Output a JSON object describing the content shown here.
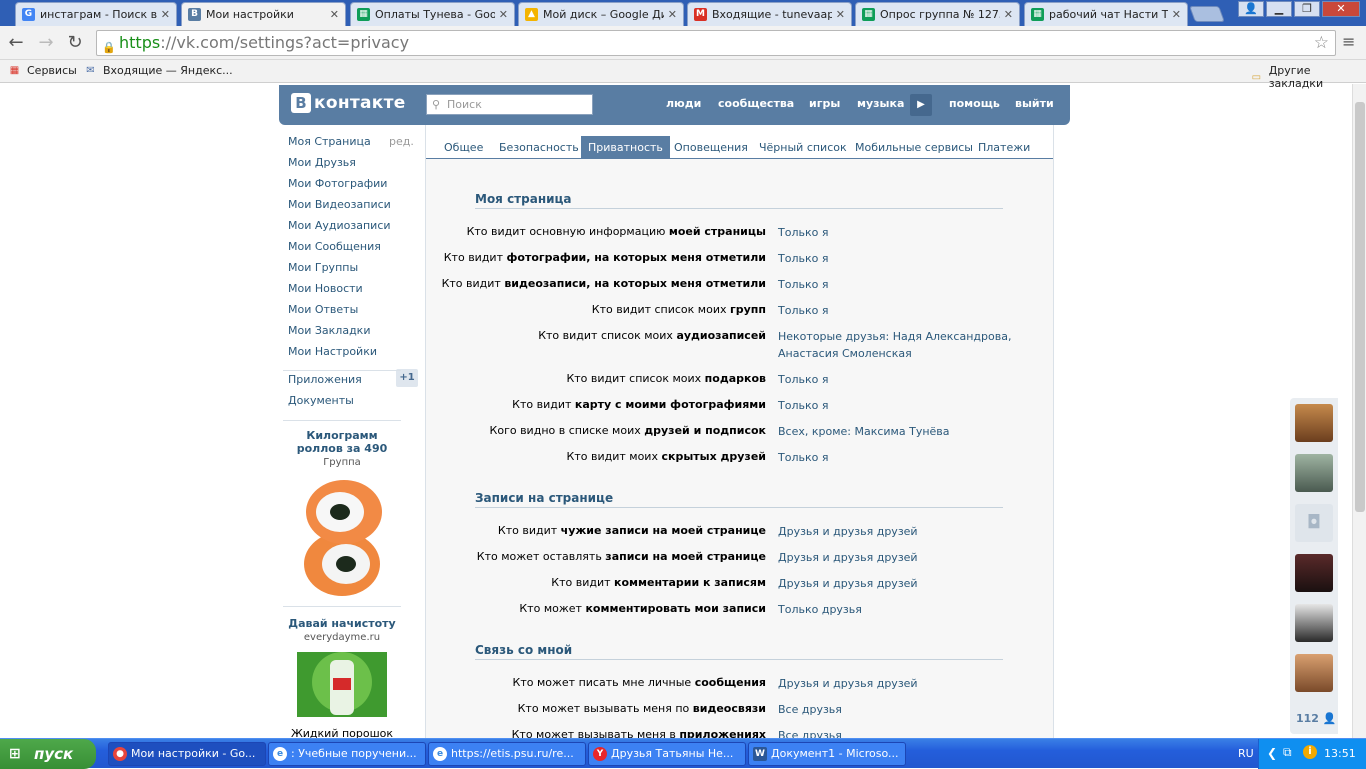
{
  "browser": {
    "tabs": [
      {
        "title": "инстаграм - Поиск в Go",
        "icon": "G",
        "color": "#4285f4"
      },
      {
        "title": "Мои настройки",
        "icon": "В",
        "color": "#597da3"
      },
      {
        "title": "Оплаты Тунева - Goog",
        "icon": "▦",
        "color": "#0f9d58"
      },
      {
        "title": "Мой диск – Google Дис",
        "icon": "▲",
        "color": "#f4b400"
      },
      {
        "title": "Входящие - tunevaap@",
        "icon": "M",
        "color": "#d93025"
      },
      {
        "title": "Опрос группа № 1275",
        "icon": "▦",
        "color": "#0f9d58"
      },
      {
        "title": "рабочий чат Насти Тун",
        "icon": "▦",
        "color": "#0f9d58"
      }
    ],
    "url_https": "https",
    "url_rest": "://vk.com/settings?act=privacy",
    "bookmarks": [
      {
        "label": "Сервисы"
      },
      {
        "label": "Входящие — Яндекс..."
      },
      {
        "label": "Другие закладки"
      }
    ]
  },
  "vk": {
    "logo_text": "контакте",
    "logo_letter": "В",
    "search_placeholder": "Поиск",
    "nav": [
      "люди",
      "сообщества",
      "игры",
      "музыка",
      "помощь",
      "выйти"
    ],
    "left_menu": [
      "Моя Страница",
      "Мои Друзья",
      "Мои Фотографии",
      "Мои Видеозаписи",
      "Мои Аудиозаписи",
      "Мои Сообщения",
      "Мои Группы",
      "Мои Новости",
      "Мои Ответы",
      "Мои Закладки",
      "Мои Настройки"
    ],
    "edit_label": "ред.",
    "apps_label": "Приложения",
    "apps_badge": "+1",
    "docs_label": "Документы",
    "ad1": {
      "title": "Килограмм роллов за 490",
      "sub": "Группа"
    },
    "ad2": {
      "title": "Давай начистоту",
      "sub": "everydayme.ru",
      "caption": "Жидкий порошок"
    },
    "settings_tabs": [
      "Общее",
      "Безопасность",
      "Приватность",
      "Оповещения",
      "Чёрный список",
      "Мобильные сервисы",
      "Платежи"
    ],
    "sections": [
      {
        "title": "Моя страница",
        "rows": [
          {
            "pre": "Кто видит основную информацию ",
            "bold": "моей страницы",
            "value": "Только я"
          },
          {
            "pre": "Кто видит ",
            "bold": "фотографии, на которых меня отметили",
            "value": "Только я"
          },
          {
            "pre": "Кто видит ",
            "bold": "видеозаписи, на которых меня отметили",
            "value": "Только я"
          },
          {
            "pre": "Кто видит список моих ",
            "bold": "групп",
            "value": "Только я"
          },
          {
            "pre": "Кто видит список моих ",
            "bold": "аудиозаписей",
            "value": "Некоторые друзья: Надя Александрова,",
            "value2": "Анастасия Смоленская"
          },
          {
            "pre": "Кто видит список моих ",
            "bold": "подарков",
            "value": "Только я"
          },
          {
            "pre": "Кто видит ",
            "bold": "карту с моими фотографиями",
            "value": "Только я"
          },
          {
            "pre": "Кого видно в списке моих ",
            "bold": "друзей и подписок",
            "value": "Всех, кроме: Максима Тунёва"
          },
          {
            "pre": "Кто видит моих ",
            "bold": "скрытых друзей",
            "value": "Только я"
          }
        ]
      },
      {
        "title": "Записи на странице",
        "rows": [
          {
            "pre": "Кто видит ",
            "bold": "чужие записи на моей странице",
            "value": "Друзья и друзья друзей"
          },
          {
            "pre": "Кто может оставлять ",
            "bold": "записи на моей странице",
            "value": "Друзья и друзья друзей"
          },
          {
            "pre": "Кто видит ",
            "bold": "комментарии к записям",
            "value": "Друзья и друзья друзей"
          },
          {
            "pre": "Кто может ",
            "bold": "комментировать мои записи",
            "value": "Только друзья"
          }
        ]
      },
      {
        "title": "Связь со мной",
        "rows": [
          {
            "pre": "Кто может писать мне личные ",
            "bold": "сообщения",
            "value": "Друзья и друзья друзей"
          },
          {
            "pre": "Кто может вызывать меня по ",
            "bold": "видеосвязи",
            "value": "Все друзья"
          },
          {
            "pre": "Кто может вызывать меня в ",
            "bold": "приложениях",
            "value": "Все друзья"
          }
        ]
      }
    ],
    "friends_count": "112"
  },
  "taskbar": {
    "start_label": "пуск",
    "buttons": [
      {
        "label": "Мои настройки - Go...",
        "icon": "●",
        "color": "#e8453c"
      },
      {
        "label": ": Учебные поручени...",
        "icon": "e",
        "color": "#3b8be0"
      },
      {
        "label": "https://etis.psu.ru/re...",
        "icon": "e",
        "color": "#3b8be0"
      },
      {
        "label": "Друзья Татьяны Не...",
        "icon": "Y",
        "color": "#e8262a"
      },
      {
        "label": "Документ1 - Microso...",
        "icon": "W",
        "color": "#2b5797"
      }
    ],
    "lang": "RU",
    "time": "13:51"
  }
}
